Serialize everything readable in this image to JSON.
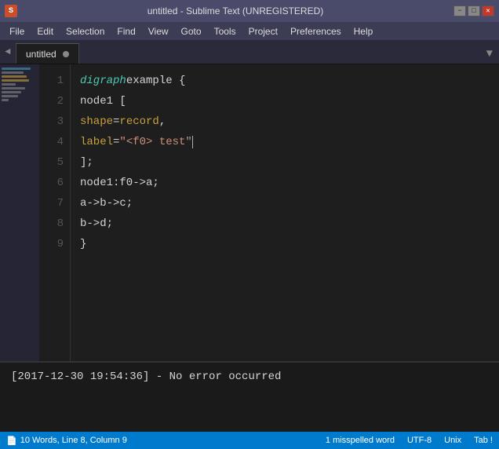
{
  "titlebar": {
    "icon": "ST",
    "title": "untitled - Sublime Text (UNREGISTERED)",
    "btn_min": "−",
    "btn_max": "□",
    "btn_close": "✕"
  },
  "menubar": {
    "items": [
      "File",
      "Edit",
      "Selection",
      "Find",
      "View",
      "Goto",
      "Tools",
      "Project",
      "Preferences",
      "Help"
    ]
  },
  "tabbar": {
    "left_arrow": "◄",
    "tab_name": "untitled",
    "dropdown_arrow": "▼"
  },
  "editor": {
    "lines": [
      {
        "num": "1",
        "tokens": [
          {
            "type": "kw",
            "text": "digraph"
          },
          {
            "type": "nm",
            "text": " example {"
          }
        ]
      },
      {
        "num": "2",
        "tokens": [
          {
            "type": "nm",
            "text": "    node1 ["
          }
        ]
      },
      {
        "num": "3",
        "tokens": [
          {
            "type": "nm",
            "text": "        "
          },
          {
            "type": "at",
            "text": "shape"
          },
          {
            "type": "nm",
            "text": "="
          },
          {
            "type": "at",
            "text": "record"
          },
          {
            "type": "nm",
            "text": ","
          }
        ]
      },
      {
        "num": "4",
        "tokens": [
          {
            "type": "nm",
            "text": "        "
          },
          {
            "type": "at",
            "text": "label"
          },
          {
            "type": "nm",
            "text": "="
          },
          {
            "type": "st",
            "text": "\"<f0> test\""
          },
          {
            "type": "cursor",
            "text": ""
          }
        ]
      },
      {
        "num": "5",
        "tokens": [
          {
            "type": "nm",
            "text": "    ];"
          }
        ]
      },
      {
        "num": "6",
        "tokens": [
          {
            "type": "nm",
            "text": "    node1:f0->a;"
          }
        ]
      },
      {
        "num": "7",
        "tokens": [
          {
            "type": "nm",
            "text": "    a->b->c;"
          }
        ]
      },
      {
        "num": "8",
        "tokens": [
          {
            "type": "nm",
            "text": "    b->d;"
          }
        ]
      },
      {
        "num": "9",
        "tokens": [
          {
            "type": "nm",
            "text": "}"
          }
        ]
      }
    ]
  },
  "output": {
    "text": "[2017-12-30 19:54:36] - No error occurred"
  },
  "statusbar": {
    "word_count": "10 Words, Line 8, Column 9",
    "spelling": "1 misspelled word",
    "encoding": "UTF-8",
    "line_ending": "Unix",
    "indent": "Tab !"
  },
  "minimap": {
    "lines": [
      {
        "width": "80%",
        "color": "#4a9ab5"
      },
      {
        "width": "60%",
        "color": "#888"
      },
      {
        "width": "70%",
        "color": "#c8a040"
      },
      {
        "width": "75%",
        "color": "#c8a040"
      },
      {
        "width": "40%",
        "color": "#888"
      },
      {
        "width": "65%",
        "color": "#888"
      },
      {
        "width": "55%",
        "color": "#888"
      },
      {
        "width": "45%",
        "color": "#888"
      },
      {
        "width": "20%",
        "color": "#888"
      }
    ]
  }
}
